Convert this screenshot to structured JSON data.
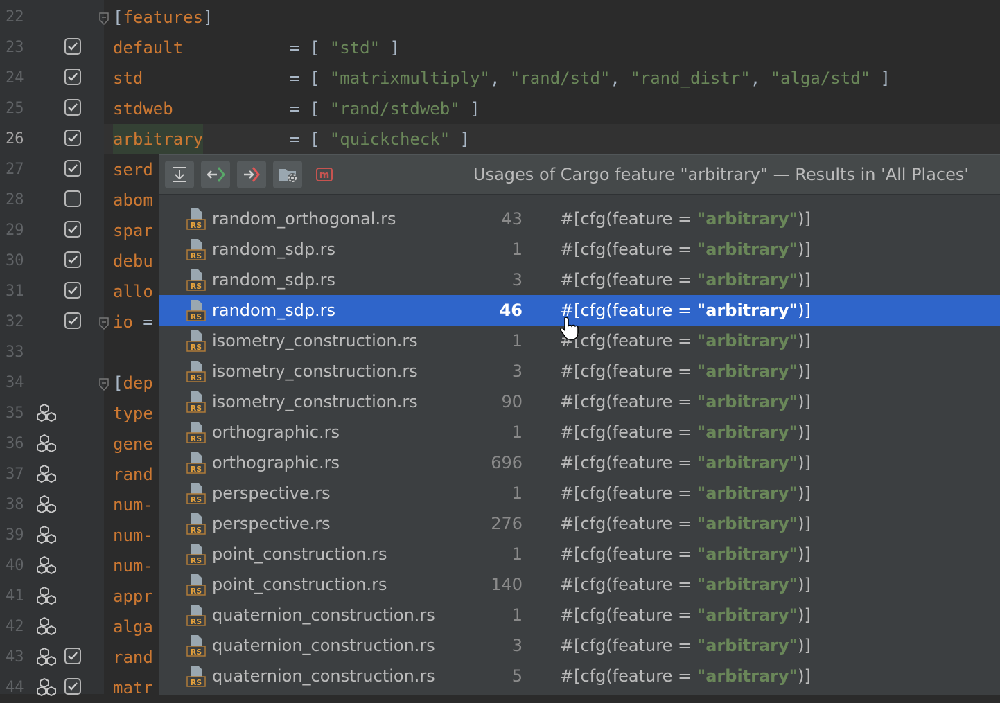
{
  "editor": {
    "lines": [
      {
        "num": "22",
        "marker": "none",
        "fold": true,
        "key": "[features]",
        "eq": "",
        "value": ""
      },
      {
        "num": "23",
        "marker": "checked",
        "fold": false,
        "key": "default",
        "eq": "=",
        "value": "[ \"std\" ]"
      },
      {
        "num": "24",
        "marker": "checked",
        "fold": false,
        "key": "std",
        "eq": "=",
        "value": "[ \"matrixmultiply\", \"rand/std\", \"rand_distr\", \"alga/std\" ]"
      },
      {
        "num": "25",
        "marker": "checked",
        "fold": false,
        "key": "stdweb",
        "eq": "=",
        "value": "[ \"rand/stdweb\" ]"
      },
      {
        "num": "26",
        "marker": "checked",
        "fold": false,
        "key": "arbitrary",
        "eq": "=",
        "value": "[ \"quickcheck\" ]",
        "current": true
      },
      {
        "num": "27",
        "marker": "checked",
        "fold": false,
        "key": "serd",
        "eq": "",
        "value": ""
      },
      {
        "num": "28",
        "marker": "unchecked",
        "fold": false,
        "key": "abom",
        "eq": "",
        "value": ""
      },
      {
        "num": "29",
        "marker": "checked",
        "fold": false,
        "key": "spar",
        "eq": "",
        "value": ""
      },
      {
        "num": "30",
        "marker": "checked",
        "fold": false,
        "key": "debu",
        "eq": "",
        "value": ""
      },
      {
        "num": "31",
        "marker": "checked",
        "fold": false,
        "key": "allo",
        "eq": "",
        "value": ""
      },
      {
        "num": "32",
        "marker": "checked",
        "fold": true,
        "key": "io =",
        "eq": "",
        "value": ""
      },
      {
        "num": "33",
        "marker": "none",
        "fold": false,
        "key": "",
        "eq": "",
        "value": ""
      },
      {
        "num": "34",
        "marker": "none",
        "fold": true,
        "key": "[dep",
        "eq": "",
        "value": ""
      },
      {
        "num": "35",
        "marker": "crate",
        "fold": false,
        "key": "type",
        "eq": "",
        "value": ""
      },
      {
        "num": "36",
        "marker": "crate",
        "fold": false,
        "key": "gene",
        "eq": "",
        "value": ""
      },
      {
        "num": "37",
        "marker": "crate",
        "fold": false,
        "key": "rand",
        "eq": "",
        "value": ""
      },
      {
        "num": "38",
        "marker": "crate",
        "fold": false,
        "key": "num-",
        "eq": "",
        "value": ""
      },
      {
        "num": "39",
        "marker": "crate",
        "fold": false,
        "key": "num-",
        "eq": "",
        "value": ""
      },
      {
        "num": "40",
        "marker": "crate",
        "fold": false,
        "key": "num-",
        "eq": "",
        "value": ""
      },
      {
        "num": "41",
        "marker": "crate",
        "fold": false,
        "key": "appr",
        "eq": "",
        "value": ""
      },
      {
        "num": "42",
        "marker": "crate",
        "fold": false,
        "key": "alga",
        "eq": "",
        "value": ""
      },
      {
        "num": "43",
        "marker": "crate-checked",
        "fold": false,
        "key": "rand",
        "eq": "",
        "value": ""
      },
      {
        "num": "44",
        "marker": "crate-checked",
        "fold": false,
        "key": "matr",
        "eq": "",
        "value": ""
      }
    ]
  },
  "popup": {
    "title": "Usages of Cargo feature \"arbitrary\" — Results in 'All Places'",
    "toolbar": [
      {
        "name": "collapse-all-button",
        "icon": "collapse-icon"
      },
      {
        "name": "previous-occurrence-button",
        "icon": "arrow-left-icon"
      },
      {
        "name": "next-occurrence-button",
        "icon": "arrow-right-icon"
      },
      {
        "name": "scope-button",
        "icon": "folder-settings-icon"
      },
      {
        "name": "merge-button",
        "icon": "merge-icon"
      }
    ],
    "snippet_prefix": "#[cfg(feature = \"",
    "snippet_keyword": "arbitrary",
    "snippet_suffix": "\")]",
    "file_icon_label": "RS",
    "results": [
      {
        "file": "random_orthogonal.rs",
        "line": "43"
      },
      {
        "file": "random_sdp.rs",
        "line": "1"
      },
      {
        "file": "random_sdp.rs",
        "line": "3"
      },
      {
        "file": "random_sdp.rs",
        "line": "46",
        "selected": true
      },
      {
        "file": "isometry_construction.rs",
        "line": "1"
      },
      {
        "file": "isometry_construction.rs",
        "line": "3"
      },
      {
        "file": "isometry_construction.rs",
        "line": "90"
      },
      {
        "file": "orthographic.rs",
        "line": "1"
      },
      {
        "file": "orthographic.rs",
        "line": "696"
      },
      {
        "file": "perspective.rs",
        "line": "1"
      },
      {
        "file": "perspective.rs",
        "line": "276"
      },
      {
        "file": "point_construction.rs",
        "line": "1"
      },
      {
        "file": "point_construction.rs",
        "line": "140"
      },
      {
        "file": "quaternion_construction.rs",
        "line": "1"
      },
      {
        "file": "quaternion_construction.rs",
        "line": "3"
      },
      {
        "file": "quaternion_construction.rs",
        "line": "5"
      }
    ]
  },
  "colors": {
    "background": "#2b2b2b",
    "gutter": "#313335",
    "key": "#cc7832",
    "string": "#6a8759",
    "popup_bg": "#3c3f41",
    "selection": "#2f65ca"
  }
}
